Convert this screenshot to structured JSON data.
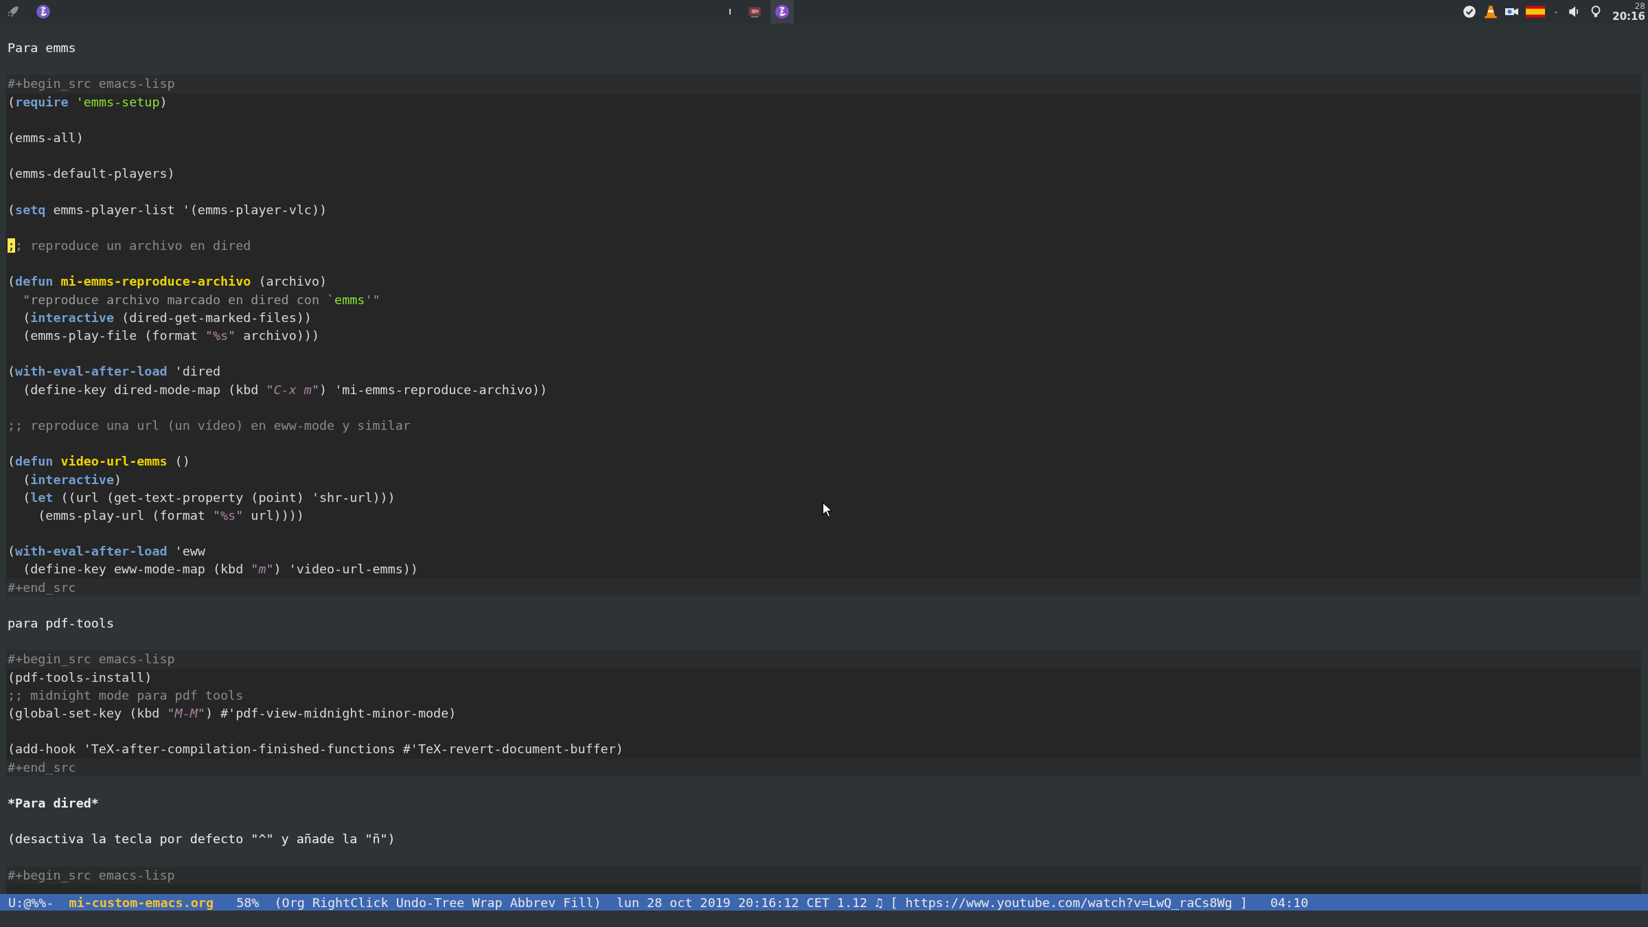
{
  "top_bar": {
    "left_icons": [
      {
        "kind": "rocket"
      },
      {
        "kind": "emacs"
      }
    ],
    "center_icons": [
      {
        "kind": "bar",
        "selected": false
      },
      {
        "kind": "recorder",
        "selected": false
      },
      {
        "kind": "emacs",
        "selected": true
      }
    ],
    "tray_icons": [
      {
        "kind": "check"
      },
      {
        "kind": "cone"
      },
      {
        "kind": "camera"
      },
      {
        "kind": "flag"
      },
      {
        "kind": "wifi"
      },
      {
        "kind": "speaker"
      },
      {
        "kind": "bulb"
      }
    ],
    "clock": {
      "day": "28",
      "time": "20:16"
    }
  },
  "blocks": [
    {
      "kind": "prose",
      "lines": [
        {
          "kind": "text",
          "text": "Para emms",
          "bold": false
        },
        {
          "kind": "blank"
        }
      ]
    },
    {
      "kind": "src",
      "header": "#+begin_src emacs-lisp",
      "footer": "#+end_src",
      "lines": [
        {
          "kind": "code",
          "tokens": [
            {
              "kind": "plain",
              "text": "("
            },
            {
              "kind": "keyword",
              "text": "require"
            },
            {
              "kind": "constant",
              "text": " 'emms-setup"
            },
            {
              "kind": "plain",
              "text": ")"
            }
          ]
        },
        {
          "kind": "blank"
        },
        {
          "kind": "code",
          "tokens": [
            {
              "kind": "plain",
              "text": "(emms-all)"
            }
          ]
        },
        {
          "kind": "blank"
        },
        {
          "kind": "code",
          "tokens": [
            {
              "kind": "plain",
              "text": "(emms-default-players)"
            }
          ]
        },
        {
          "kind": "blank"
        },
        {
          "kind": "code",
          "tokens": [
            {
              "kind": "plain",
              "text": "("
            },
            {
              "kind": "keyword",
              "text": "setq"
            },
            {
              "kind": "plain",
              "text": " emms-player-list '(emms-player-vlc))"
            }
          ]
        },
        {
          "kind": "blank"
        },
        {
          "kind": "code",
          "tokens": [
            {
              "kind": "cursor",
              "text": ";"
            },
            {
              "kind": "comment",
              "text": "; reproduce un archivo en dired"
            }
          ]
        },
        {
          "kind": "blank"
        },
        {
          "kind": "code",
          "tokens": [
            {
              "kind": "plain",
              "text": "("
            },
            {
              "kind": "keyword",
              "text": "defun"
            },
            {
              "kind": "function",
              "text": " mi-emms-reproduce-archivo"
            },
            {
              "kind": "plain",
              "text": " (archivo)"
            }
          ]
        },
        {
          "kind": "code",
          "tokens": [
            {
              "kind": "doc",
              "text": "  \"reproduce archivo marcado en dired con `"
            },
            {
              "kind": "constant",
              "text": "emms"
            },
            {
              "kind": "doc",
              "text": "'\""
            }
          ]
        },
        {
          "kind": "code",
          "tokens": [
            {
              "kind": "plain",
              "text": "  ("
            },
            {
              "kind": "keyword",
              "text": "interactive"
            },
            {
              "kind": "plain",
              "text": " (dired-get-marked-files))"
            }
          ]
        },
        {
          "kind": "code",
          "tokens": [
            {
              "kind": "plain",
              "text": "  (emms-play-file (format "
            },
            {
              "kind": "doc",
              "text": "\""
            },
            {
              "kind": "escape",
              "text": "%s"
            },
            {
              "kind": "doc",
              "text": "\""
            },
            {
              "kind": "plain",
              "text": " archivo)))"
            }
          ]
        },
        {
          "kind": "blank"
        },
        {
          "kind": "code",
          "tokens": [
            {
              "kind": "plain",
              "text": "("
            },
            {
              "kind": "keyword",
              "text": "with-eval-after-load"
            },
            {
              "kind": "plain",
              "text": " 'dired"
            }
          ]
        },
        {
          "kind": "code",
          "tokens": [
            {
              "kind": "plain",
              "text": "  (define-key dired-mode-map (kbd "
            },
            {
              "kind": "doc",
              "text": "\""
            },
            {
              "kind": "key",
              "text": "C-x m"
            },
            {
              "kind": "doc",
              "text": "\""
            },
            {
              "kind": "plain",
              "text": ") 'mi-emms-reproduce-archivo))"
            }
          ]
        },
        {
          "kind": "blank"
        },
        {
          "kind": "code",
          "tokens": [
            {
              "kind": "comment",
              "text": ";; reproduce una url (un vídeo) en eww-mode y similar"
            }
          ]
        },
        {
          "kind": "blank"
        },
        {
          "kind": "code",
          "tokens": [
            {
              "kind": "plain",
              "text": "("
            },
            {
              "kind": "keyword",
              "text": "defun"
            },
            {
              "kind": "function",
              "text": " video-url-emms"
            },
            {
              "kind": "plain",
              "text": " ()"
            }
          ]
        },
        {
          "kind": "code",
          "tokens": [
            {
              "kind": "plain",
              "text": "  ("
            },
            {
              "kind": "keyword",
              "text": "interactive"
            },
            {
              "kind": "plain",
              "text": ")"
            }
          ]
        },
        {
          "kind": "code",
          "tokens": [
            {
              "kind": "plain",
              "text": "  ("
            },
            {
              "kind": "keyword",
              "text": "let"
            },
            {
              "kind": "plain",
              "text": " ((url (get-text-property (point) 'shr-url)))"
            }
          ]
        },
        {
          "kind": "code",
          "tokens": [
            {
              "kind": "plain",
              "text": "    (emms-play-url (format "
            },
            {
              "kind": "doc",
              "text": "\""
            },
            {
              "kind": "escape",
              "text": "%s"
            },
            {
              "kind": "doc",
              "text": "\""
            },
            {
              "kind": "plain",
              "text": " url))))"
            }
          ]
        },
        {
          "kind": "blank"
        },
        {
          "kind": "code",
          "tokens": [
            {
              "kind": "plain",
              "text": "("
            },
            {
              "kind": "keyword",
              "text": "with-eval-after-load"
            },
            {
              "kind": "plain",
              "text": " 'eww"
            }
          ]
        },
        {
          "kind": "code",
          "tokens": [
            {
              "kind": "plain",
              "text": "  (define-key eww-mode-map (kbd "
            },
            {
              "kind": "doc",
              "text": "\""
            },
            {
              "kind": "key",
              "text": "m"
            },
            {
              "kind": "doc",
              "text": "\""
            },
            {
              "kind": "plain",
              "text": ") 'video-url-emms))"
            }
          ]
        }
      ]
    },
    {
      "kind": "prose",
      "lines": [
        {
          "kind": "blank"
        },
        {
          "kind": "text",
          "text": "para pdf-tools",
          "bold": false
        },
        {
          "kind": "blank"
        }
      ]
    },
    {
      "kind": "src",
      "header": "#+begin_src emacs-lisp",
      "footer": "#+end_src",
      "lines": [
        {
          "kind": "code",
          "tokens": [
            {
              "kind": "plain",
              "text": "(pdf-tools-install)"
            }
          ]
        },
        {
          "kind": "code",
          "tokens": [
            {
              "kind": "comment",
              "text": ";; midnight mode para pdf tools"
            }
          ]
        },
        {
          "kind": "code",
          "tokens": [
            {
              "kind": "plain",
              "text": "(global-set-key (kbd "
            },
            {
              "kind": "doc",
              "text": "\""
            },
            {
              "kind": "key",
              "text": "M-M"
            },
            {
              "kind": "doc",
              "text": "\""
            },
            {
              "kind": "plain",
              "text": ") #'pdf-view-midnight-minor-mode)"
            }
          ]
        },
        {
          "kind": "blank"
        },
        {
          "kind": "code",
          "tokens": [
            {
              "kind": "plain",
              "text": "(add-hook 'TeX-after-compilation-finished-functions #'TeX-revert-document-buffer)"
            }
          ]
        }
      ]
    },
    {
      "kind": "prose",
      "lines": [
        {
          "kind": "blank"
        },
        {
          "kind": "text",
          "text": "*Para dired*",
          "bold": true
        },
        {
          "kind": "blank"
        },
        {
          "kind": "text",
          "text": "(desactiva la tecla por defecto \"^\" y añade la \"ñ\")",
          "bold": false
        },
        {
          "kind": "blank"
        }
      ]
    },
    {
      "kind": "src",
      "header": "#+begin_src emacs-lisp",
      "lines": [
        {
          "kind": "blank"
        }
      ]
    }
  ],
  "mode_line": [
    {
      "kind": "plain",
      "text": "U:@%%-"
    },
    {
      "kind": "buffer",
      "text": "mi-custom-emacs.org"
    },
    {
      "kind": "plain",
      "text": " 58%"
    },
    {
      "kind": "plain",
      "text": "(Org RightClick Undo-Tree Wrap Abbrev Fill)"
    },
    {
      "kind": "plain",
      "text": "lun 28 oct 2019 20:16:12 CET 1.12 ♫ [ https://www.youtube.com/watch?v=LwQ_raCs8Wg ]"
    },
    {
      "kind": "plain",
      "text": " 04:10"
    }
  ]
}
